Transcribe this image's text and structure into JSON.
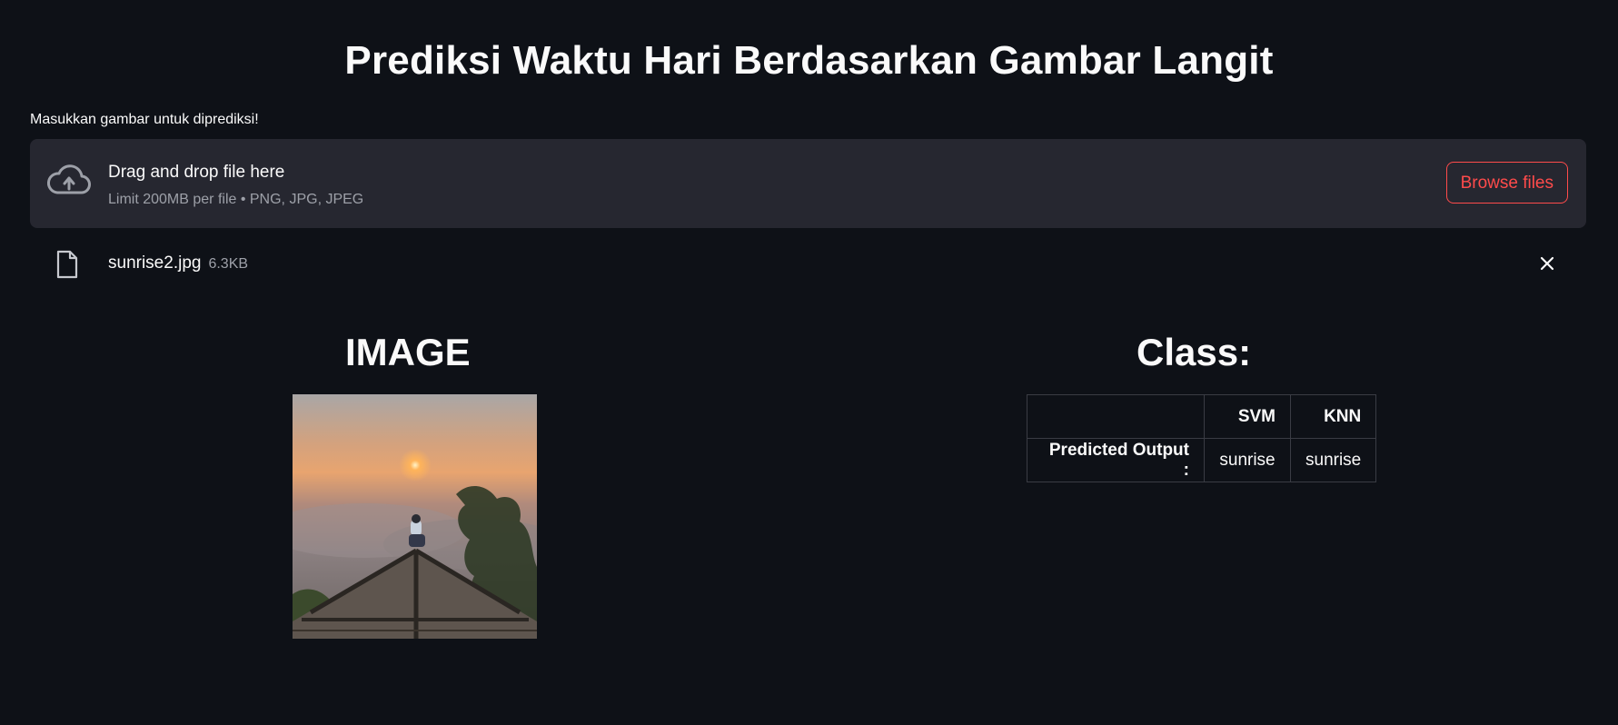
{
  "page": {
    "title": "Prediksi Waktu Hari Berdasarkan Gambar Langit"
  },
  "uploader": {
    "label": "Masukkan gambar untuk diprediksi!",
    "drop_text": "Drag and drop file here",
    "limit_text": "Limit 200MB per file • PNG, JPG, JPEG",
    "browse_label": "Browse files",
    "icon": "cloud-upload-icon",
    "accent_color": "#ff4b4b"
  },
  "uploaded_file": {
    "name": "sunrise2.jpg",
    "size": "6.3KB",
    "icon": "file-icon",
    "remove_icon": "close-icon"
  },
  "image_section": {
    "heading": "IMAGE"
  },
  "class_section": {
    "heading": "Class:",
    "table": {
      "headers": [
        "",
        "SVM",
        "KNN"
      ],
      "rows": [
        {
          "label": "Predicted Output :",
          "svm": "sunrise",
          "knn": "sunrise"
        }
      ]
    }
  },
  "colors": {
    "background": "#0e1117",
    "panel": "#262730",
    "text": "#fafafa",
    "muted": "#9da0a8"
  }
}
